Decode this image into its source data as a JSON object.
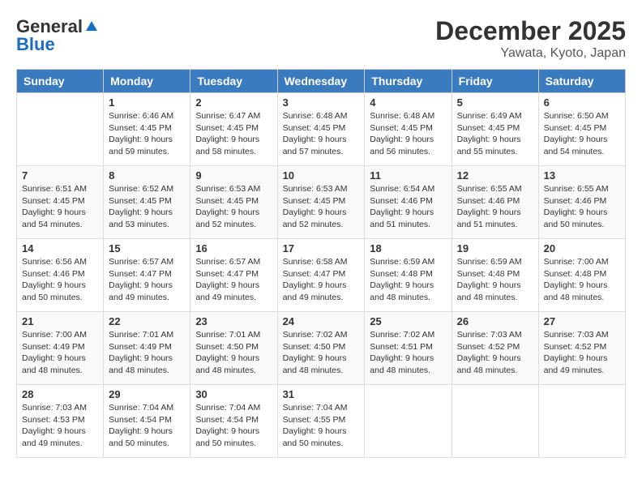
{
  "header": {
    "logo_general": "General",
    "logo_blue": "Blue",
    "month_title": "December 2025",
    "location": "Yawata, Kyoto, Japan"
  },
  "days_of_week": [
    "Sunday",
    "Monday",
    "Tuesday",
    "Wednesday",
    "Thursday",
    "Friday",
    "Saturday"
  ],
  "weeks": [
    [
      {
        "day": "",
        "sunrise": "",
        "sunset": "",
        "daylight": ""
      },
      {
        "day": "1",
        "sunrise": "6:46 AM",
        "sunset": "4:45 PM",
        "daylight": "9 hours and 59 minutes."
      },
      {
        "day": "2",
        "sunrise": "6:47 AM",
        "sunset": "4:45 PM",
        "daylight": "9 hours and 58 minutes."
      },
      {
        "day": "3",
        "sunrise": "6:48 AM",
        "sunset": "4:45 PM",
        "daylight": "9 hours and 57 minutes."
      },
      {
        "day": "4",
        "sunrise": "6:48 AM",
        "sunset": "4:45 PM",
        "daylight": "9 hours and 56 minutes."
      },
      {
        "day": "5",
        "sunrise": "6:49 AM",
        "sunset": "4:45 PM",
        "daylight": "9 hours and 55 minutes."
      },
      {
        "day": "6",
        "sunrise": "6:50 AM",
        "sunset": "4:45 PM",
        "daylight": "9 hours and 54 minutes."
      }
    ],
    [
      {
        "day": "7",
        "sunrise": "6:51 AM",
        "sunset": "4:45 PM",
        "daylight": "9 hours and 54 minutes."
      },
      {
        "day": "8",
        "sunrise": "6:52 AM",
        "sunset": "4:45 PM",
        "daylight": "9 hours and 53 minutes."
      },
      {
        "day": "9",
        "sunrise": "6:53 AM",
        "sunset": "4:45 PM",
        "daylight": "9 hours and 52 minutes."
      },
      {
        "day": "10",
        "sunrise": "6:53 AM",
        "sunset": "4:45 PM",
        "daylight": "9 hours and 52 minutes."
      },
      {
        "day": "11",
        "sunrise": "6:54 AM",
        "sunset": "4:46 PM",
        "daylight": "9 hours and 51 minutes."
      },
      {
        "day": "12",
        "sunrise": "6:55 AM",
        "sunset": "4:46 PM",
        "daylight": "9 hours and 51 minutes."
      },
      {
        "day": "13",
        "sunrise": "6:55 AM",
        "sunset": "4:46 PM",
        "daylight": "9 hours and 50 minutes."
      }
    ],
    [
      {
        "day": "14",
        "sunrise": "6:56 AM",
        "sunset": "4:46 PM",
        "daylight": "9 hours and 50 minutes."
      },
      {
        "day": "15",
        "sunrise": "6:57 AM",
        "sunset": "4:47 PM",
        "daylight": "9 hours and 49 minutes."
      },
      {
        "day": "16",
        "sunrise": "6:57 AM",
        "sunset": "4:47 PM",
        "daylight": "9 hours and 49 minutes."
      },
      {
        "day": "17",
        "sunrise": "6:58 AM",
        "sunset": "4:47 PM",
        "daylight": "9 hours and 49 minutes."
      },
      {
        "day": "18",
        "sunrise": "6:59 AM",
        "sunset": "4:48 PM",
        "daylight": "9 hours and 48 minutes."
      },
      {
        "day": "19",
        "sunrise": "6:59 AM",
        "sunset": "4:48 PM",
        "daylight": "9 hours and 48 minutes."
      },
      {
        "day": "20",
        "sunrise": "7:00 AM",
        "sunset": "4:48 PM",
        "daylight": "9 hours and 48 minutes."
      }
    ],
    [
      {
        "day": "21",
        "sunrise": "7:00 AM",
        "sunset": "4:49 PM",
        "daylight": "9 hours and 48 minutes."
      },
      {
        "day": "22",
        "sunrise": "7:01 AM",
        "sunset": "4:49 PM",
        "daylight": "9 hours and 48 minutes."
      },
      {
        "day": "23",
        "sunrise": "7:01 AM",
        "sunset": "4:50 PM",
        "daylight": "9 hours and 48 minutes."
      },
      {
        "day": "24",
        "sunrise": "7:02 AM",
        "sunset": "4:50 PM",
        "daylight": "9 hours and 48 minutes."
      },
      {
        "day": "25",
        "sunrise": "7:02 AM",
        "sunset": "4:51 PM",
        "daylight": "9 hours and 48 minutes."
      },
      {
        "day": "26",
        "sunrise": "7:03 AM",
        "sunset": "4:52 PM",
        "daylight": "9 hours and 48 minutes."
      },
      {
        "day": "27",
        "sunrise": "7:03 AM",
        "sunset": "4:52 PM",
        "daylight": "9 hours and 49 minutes."
      }
    ],
    [
      {
        "day": "28",
        "sunrise": "7:03 AM",
        "sunset": "4:53 PM",
        "daylight": "9 hours and 49 minutes."
      },
      {
        "day": "29",
        "sunrise": "7:04 AM",
        "sunset": "4:54 PM",
        "daylight": "9 hours and 50 minutes."
      },
      {
        "day": "30",
        "sunrise": "7:04 AM",
        "sunset": "4:54 PM",
        "daylight": "9 hours and 50 minutes."
      },
      {
        "day": "31",
        "sunrise": "7:04 AM",
        "sunset": "4:55 PM",
        "daylight": "9 hours and 50 minutes."
      },
      {
        "day": "",
        "sunrise": "",
        "sunset": "",
        "daylight": ""
      },
      {
        "day": "",
        "sunrise": "",
        "sunset": "",
        "daylight": ""
      },
      {
        "day": "",
        "sunrise": "",
        "sunset": "",
        "daylight": ""
      }
    ]
  ]
}
